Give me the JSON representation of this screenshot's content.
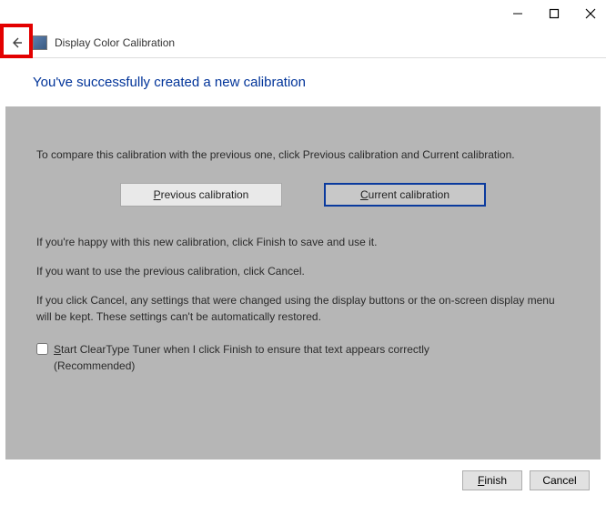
{
  "window": {
    "title": "Display Color Calibration"
  },
  "heading": "You've successfully created a new calibration",
  "content": {
    "compare_intro": "To compare this calibration with the previous one, click Previous calibration and Current calibration.",
    "prev_btn": "Previous calibration",
    "curr_btn": "Current calibration",
    "happy_text": "If you're happy with this new calibration, click Finish to save and use it.",
    "use_prev_text": "If you want to use the previous calibration, click Cancel.",
    "cancel_note": "If you click Cancel, any settings that were changed using the display buttons or the on-screen display menu will be kept. These settings can't be automatically restored.",
    "cleartype_label_1": "Start ClearType Tuner when I click Finish to ensure that text appears correctly ",
    "cleartype_label_2": "(Recommended)"
  },
  "footer": {
    "finish": "Finish",
    "cancel": "Cancel"
  }
}
